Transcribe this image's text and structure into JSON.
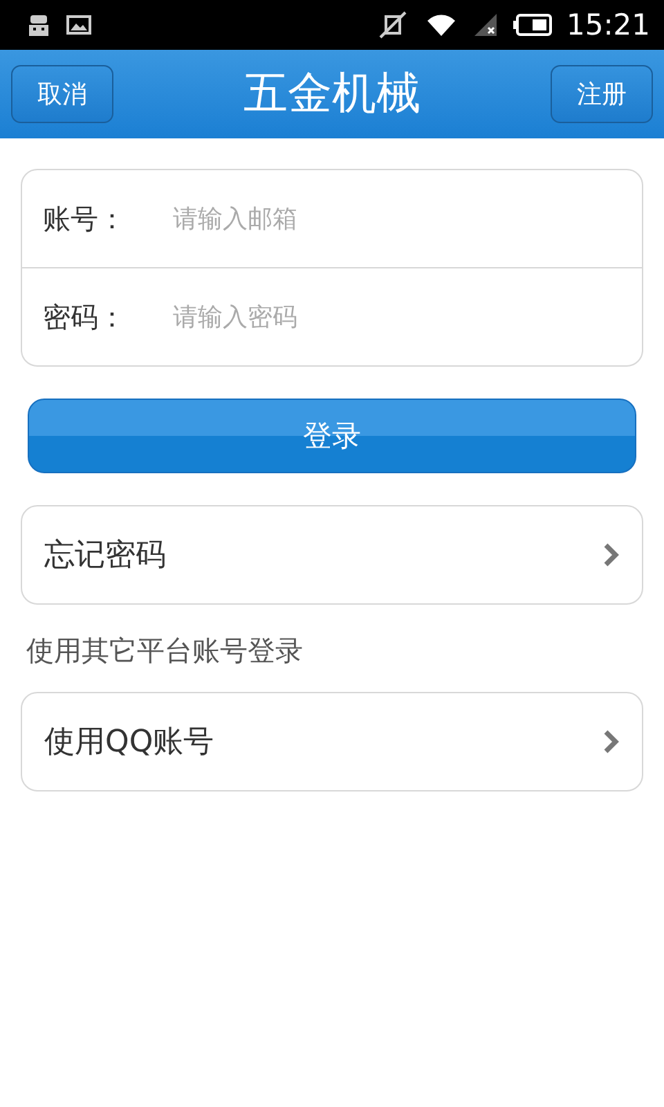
{
  "status_bar": {
    "time": "15:21"
  },
  "header": {
    "title": "五金机械",
    "left_button": "取消",
    "right_button": "注册"
  },
  "form": {
    "fields": [
      {
        "label": "账号：",
        "placeholder": "请输入邮箱"
      },
      {
        "label": "密码：",
        "placeholder": "请输入密码"
      }
    ]
  },
  "login_button": "登录",
  "forgot_item": "忘记密码",
  "other_heading": "使用其它平台账号登录",
  "other_items": [
    "使用QQ账号"
  ]
}
